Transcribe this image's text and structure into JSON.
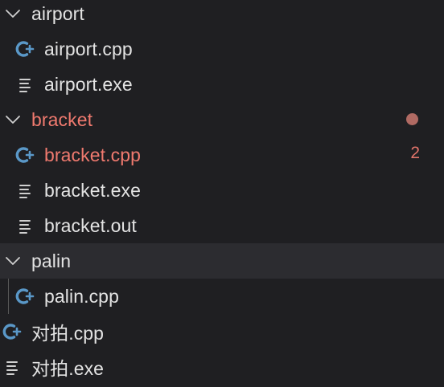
{
  "explorer": {
    "folders": {
      "airport": {
        "label": "airport"
      },
      "bracket": {
        "label": "bracket",
        "problems": "2"
      },
      "palin": {
        "label": "palin"
      }
    },
    "files": {
      "airport_cpp": "airport.cpp",
      "airport_exe": "airport.exe",
      "bracket_cpp": "bracket.cpp",
      "bracket_exe": "bracket.exe",
      "bracket_out": "bracket.out",
      "palin_cpp": "palin.cpp",
      "duipai_cpp": "对拍.cpp",
      "duipai_exe": "对拍.exe"
    },
    "colors": {
      "background": "#1f1f22",
      "text": "#e3e3e3",
      "error": "#f07a6f",
      "cpp_icon": "#5a98c8",
      "hover_row": "#2c2c30"
    }
  }
}
